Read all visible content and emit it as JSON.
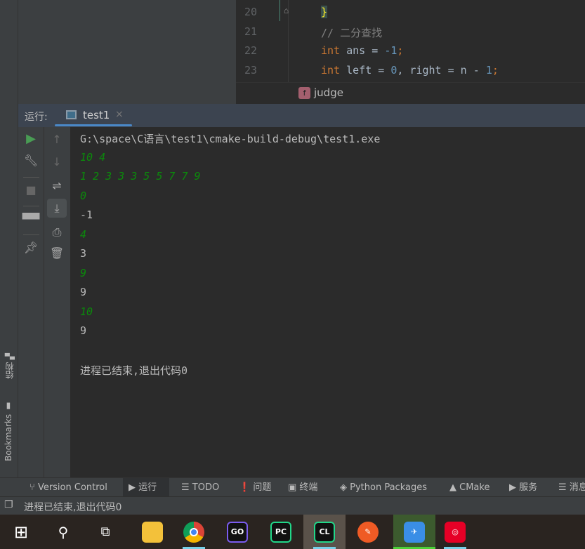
{
  "editor": {
    "lines": [
      {
        "n": "20",
        "text": "}"
      },
      {
        "n": "21",
        "text": "// 二分查找"
      },
      {
        "n": "22",
        "kw": "int",
        "rest": " ans = ",
        "num": "-1",
        "end": ";"
      },
      {
        "n": "23",
        "kw": "int",
        "rest": " left = ",
        "num": "0",
        "mid": ", right = n - ",
        "num2": "1",
        "end": ";"
      }
    ],
    "breadcrumb": {
      "icon": "f",
      "label": "judge"
    }
  },
  "run": {
    "label": "运行:",
    "tab": "test1"
  },
  "console": {
    "lines": [
      {
        "text": "G:\\space\\C语言\\test1\\cmake-build-debug\\test1.exe",
        "kind": "out"
      },
      {
        "text": "10 4",
        "kind": "in"
      },
      {
        "text": "1 2 3 3 3 5 5 7 7 9",
        "kind": "in"
      },
      {
        "text": "0",
        "kind": "in"
      },
      {
        "text": "-1",
        "kind": "out"
      },
      {
        "text": "4",
        "kind": "in"
      },
      {
        "text": "3",
        "kind": "out"
      },
      {
        "text": "9",
        "kind": "in"
      },
      {
        "text": "9",
        "kind": "out"
      },
      {
        "text": "10",
        "kind": "in"
      },
      {
        "text": "9",
        "kind": "out"
      },
      {
        "text": "",
        "kind": "out"
      },
      {
        "text": "进程已结束,退出代码0",
        "kind": "out"
      }
    ]
  },
  "side": {
    "structure": "结构",
    "bookmarks": "Bookmarks"
  },
  "toolwindows": [
    "Version Control",
    "运行",
    "TODO",
    "问题",
    "终端",
    "Python Packages",
    "CMake",
    "服务",
    "消息"
  ],
  "status": "进程已结束,退出代码0",
  "taskbar": {
    "apps": [
      "GO",
      "PC",
      "CL"
    ]
  },
  "colors": {
    "accent": "#4a88c7",
    "input": "#0b8a0b",
    "run": "#499c54"
  }
}
